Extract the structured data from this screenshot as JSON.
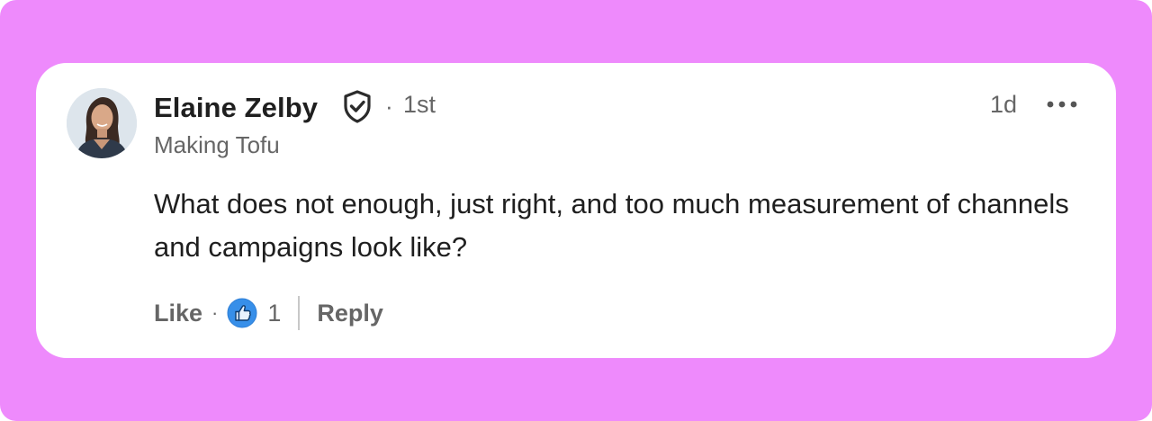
{
  "colors": {
    "frame_background": "#ee8afc",
    "card_background": "#ffffff",
    "primary_text": "#1f1f1f",
    "secondary_text": "#666666",
    "like_reaction_blue": "#378fe9"
  },
  "comment": {
    "author": {
      "name": "Elaine Zelby",
      "verified_icon": "verified-shield-check-icon",
      "degree": "1st",
      "headline": "Making Tofu",
      "avatar": "profile-photo"
    },
    "timestamp": "1d",
    "menu_icon": "more-horizontal-icon",
    "text": "What does not enough, just right, and too much measurement of channels and campaigns look like?",
    "actions": {
      "like_label": "Like",
      "reaction_icon": "like-thumbs-up-icon",
      "reaction_count": "1",
      "reply_label": "Reply"
    }
  }
}
